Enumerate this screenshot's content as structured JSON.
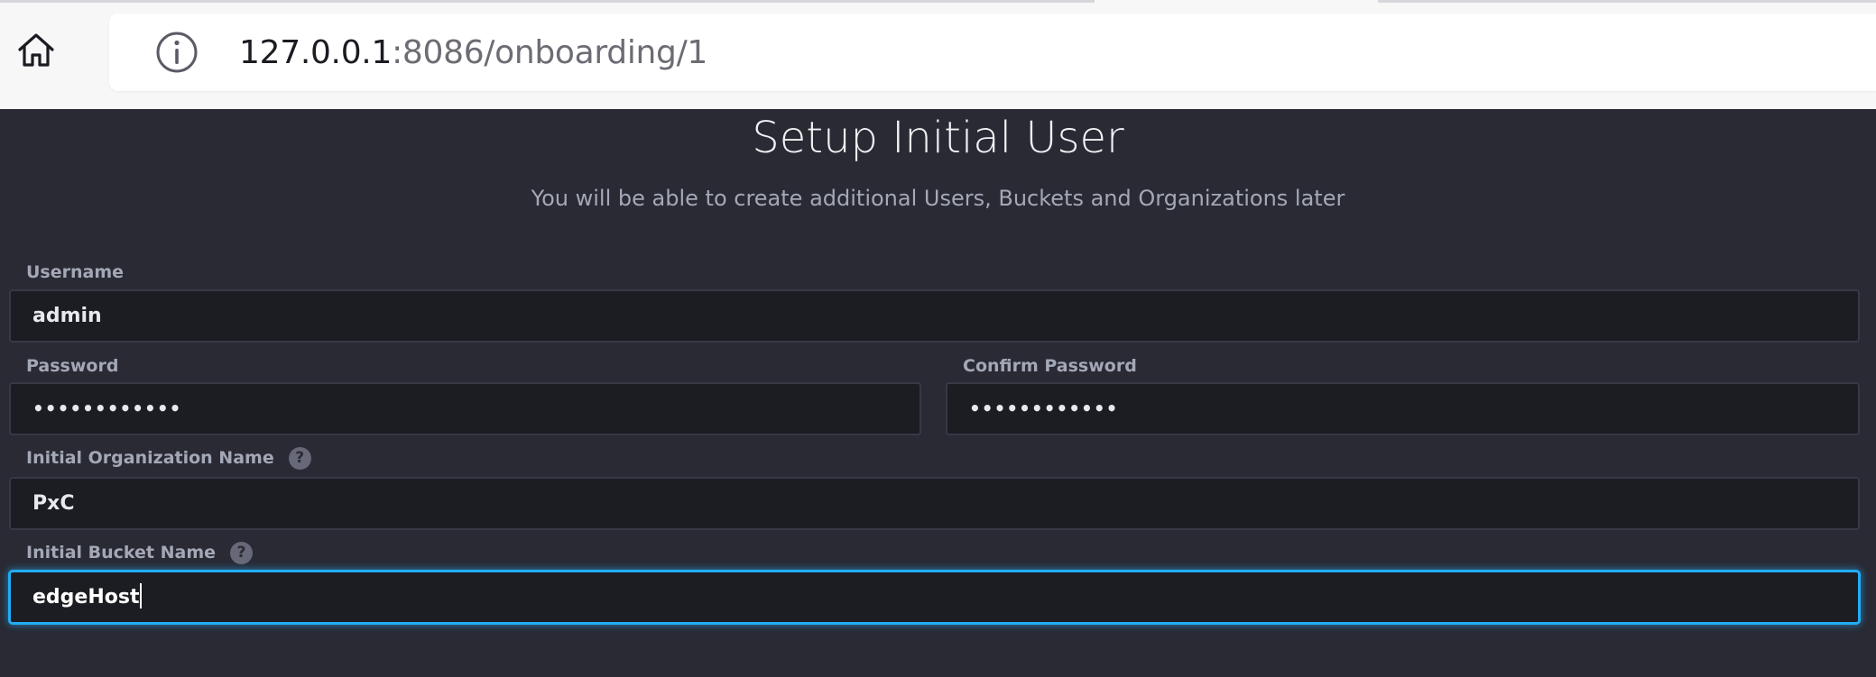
{
  "browser": {
    "url_host": "127.0.0.1",
    "url_rest": ":8086/onboarding/1",
    "home_icon": "home-icon",
    "info_icon": "info-icon"
  },
  "page": {
    "title": "Setup Initial User",
    "subtitle": "You will be able to create additional Users, Buckets and Organizations later"
  },
  "form": {
    "username": {
      "label": "Username",
      "value": "admin"
    },
    "password": {
      "label": "Password",
      "value": "••••••••••••"
    },
    "confirm_password": {
      "label": "Confirm Password",
      "value": "••••••••••••"
    },
    "org_name": {
      "label": "Initial Organization Name",
      "value": "PxC",
      "help": "?"
    },
    "bucket_name": {
      "label": "Initial Bucket Name",
      "value": "edgeHost",
      "help": "?"
    }
  },
  "colors": {
    "page_bg": "#292a34",
    "input_bg": "#1c1c23",
    "focus_accent": "#22adf6",
    "label": "#a4a8b6"
  }
}
